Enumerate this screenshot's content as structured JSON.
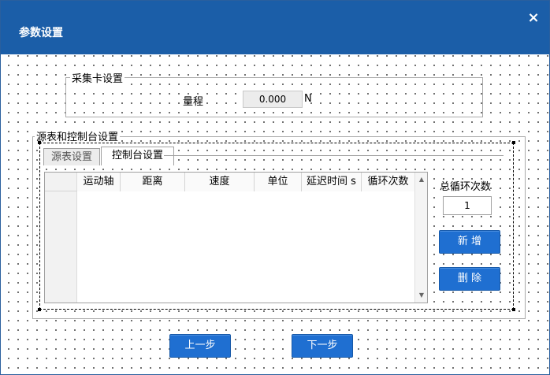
{
  "window": {
    "title": "参数设置",
    "close_glyph": "×",
    "accent_color": "#1b5ea8"
  },
  "acquisition": {
    "legend": "采集卡设置",
    "range_label": "量程",
    "range_value": "0.000",
    "range_unit": "N"
  },
  "source_console": {
    "legend": "源表和控制台设置",
    "tabs": [
      {
        "label": "源表设置",
        "selected": false
      },
      {
        "label": "控制台设置",
        "selected": true
      }
    ],
    "columns": [
      "运动轴",
      "距离",
      "速度",
      "单位",
      "延迟时间 s",
      "循环次数"
    ],
    "rows": [],
    "total_cycles_label": "总循环次数",
    "total_cycles_value": "1",
    "add_label": "新 增",
    "delete_label": "删 除"
  },
  "footer": {
    "prev_label": "上一步",
    "next_label": "下一步"
  },
  "icons": {
    "scroll_up": "▲",
    "scroll_down": "▼"
  }
}
